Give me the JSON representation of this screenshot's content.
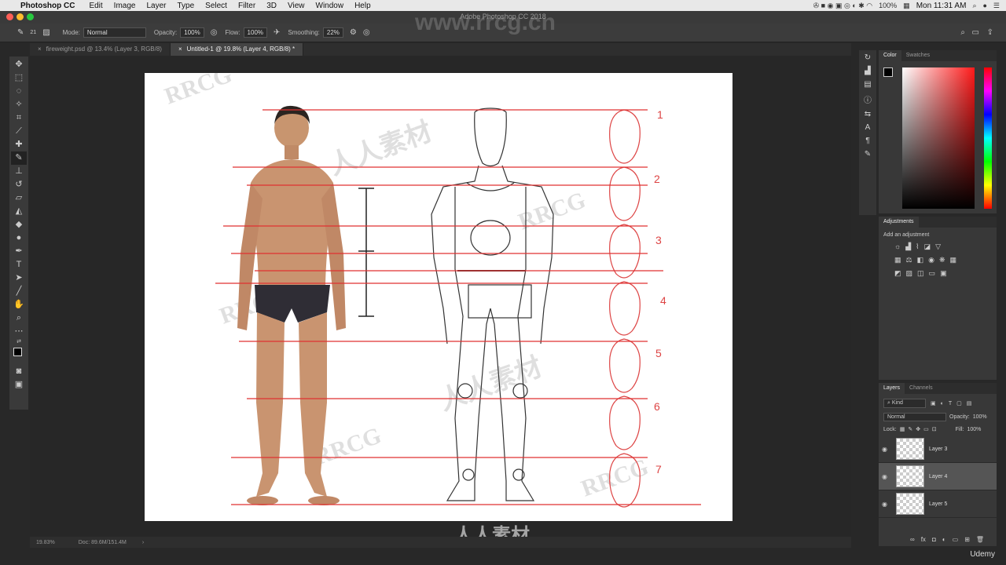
{
  "menubar": {
    "app_name": "Photoshop CC",
    "menus": [
      "Edit",
      "Image",
      "Layer",
      "Type",
      "Select",
      "Filter",
      "3D",
      "View",
      "Window",
      "Help"
    ],
    "battery": "100%",
    "clock": "Mon 11:31 AM"
  },
  "window": {
    "title": "Adobe Photoshop CC 2018"
  },
  "options": {
    "mode_label": "Mode:",
    "mode_value": "Normal",
    "opacity_label": "Opacity:",
    "opacity_value": "100%",
    "flow_label": "Flow:",
    "flow_value": "100%",
    "smoothing_label": "Smoothing:",
    "smoothing_value": "22%",
    "brush_size": "21"
  },
  "tabs": [
    {
      "label": "fireweight.psd @ 13.4% (Layer 3, RGB/8)"
    },
    {
      "label": "Untitled-1 @ 19.8% (Layer 4, RGB/8) *"
    }
  ],
  "canvas": {
    "head_numbers": [
      "1",
      "2",
      "3",
      "4",
      "5",
      "6",
      "7"
    ]
  },
  "status": {
    "zoom": "19.83%",
    "doc": "Doc: 89.6M/151.4M"
  },
  "color_panel": {
    "tab_color": "Color",
    "tab_swatches": "Swatches"
  },
  "adjustments": {
    "title": "Adjustments",
    "subtitle": "Add an adjustment"
  },
  "layers_panel": {
    "tab_layers": "Layers",
    "tab_channels": "Channels",
    "kind": "Kind",
    "blend": "Normal",
    "opacity_label": "Opacity:",
    "opacity_value": "100%",
    "lock_label": "Lock:",
    "fill_label": "Fill:",
    "fill_value": "100%",
    "layers": [
      {
        "name": "Layer 3"
      },
      {
        "name": "Layer 4"
      },
      {
        "name": "Layer 5"
      }
    ]
  },
  "watermark": {
    "url": "www.rrcg.cn",
    "brand": "RRCG",
    "cn": "人人素材",
    "udemy": "Udemy"
  }
}
